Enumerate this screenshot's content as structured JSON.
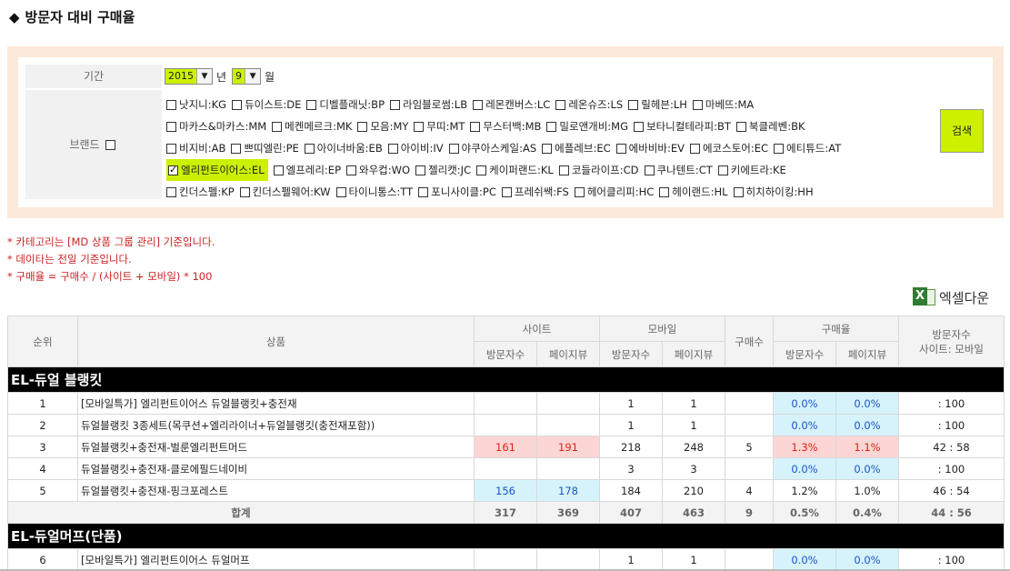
{
  "page": {
    "title": "방문자 대비 구매율",
    "title_icon": "◆"
  },
  "filter": {
    "period_label": "기간",
    "year_value": "2015",
    "year_unit": "년",
    "month_value": "9",
    "month_unit": "월",
    "brand_label": "브랜드",
    "search_label": "검색",
    "brand_rows": [
      [
        {
          "label": "낫지니:KG",
          "checked": false
        },
        {
          "label": "듀이스트:DE",
          "checked": false
        },
        {
          "label": "디벨플래닛:BP",
          "checked": false
        },
        {
          "label": "라임블로썸:LB",
          "checked": false
        },
        {
          "label": "레몬캔버스:LC",
          "checked": false
        },
        {
          "label": "레온슈즈:LS",
          "checked": false
        },
        {
          "label": "릴헤븐:LH",
          "checked": false
        },
        {
          "label": "마베뜨:MA",
          "checked": false
        }
      ],
      [
        {
          "label": "마카스&마카스:MM",
          "checked": false
        },
        {
          "label": "메켄메르크:MK",
          "checked": false
        },
        {
          "label": "모음:MY",
          "checked": false
        },
        {
          "label": "무띠:MT",
          "checked": false
        },
        {
          "label": "무스터백:MB",
          "checked": false
        },
        {
          "label": "밀로앤개비:MG",
          "checked": false
        },
        {
          "label": "보타니컬테라피:BT",
          "checked": false
        },
        {
          "label": "북클레벤:BK",
          "checked": false
        }
      ],
      [
        {
          "label": "비지비:AB",
          "checked": false
        },
        {
          "label": "쁘띠엘린:PE",
          "checked": false
        },
        {
          "label": "아이너바움:EB",
          "checked": false
        },
        {
          "label": "아이비:IV",
          "checked": false
        },
        {
          "label": "야쿠아스케일:AS",
          "checked": false
        },
        {
          "label": "에플레브:EC",
          "checked": false
        },
        {
          "label": "에바비바:EV",
          "checked": false
        },
        {
          "label": "에코스토어:EC",
          "checked": false
        },
        {
          "label": "에티튜드:AT",
          "checked": false
        }
      ],
      [
        {
          "label": "엘리펀트이어스:EL",
          "checked": true
        },
        {
          "label": "엘프레리:EP",
          "checked": false
        },
        {
          "label": "와우컵:WO",
          "checked": false
        },
        {
          "label": "젤리캣:JC",
          "checked": false
        },
        {
          "label": "케이퍼랜드:KL",
          "checked": false
        },
        {
          "label": "코들라이프:CD",
          "checked": false
        },
        {
          "label": "쿠나텐트:CT",
          "checked": false
        },
        {
          "label": "키에트라:KE",
          "checked": false
        }
      ],
      [
        {
          "label": "킨더스펠:KP",
          "checked": false
        },
        {
          "label": "킨더스펠웨어:KW",
          "checked": false
        },
        {
          "label": "타이니통스:TT",
          "checked": false
        },
        {
          "label": "포니사이클:PC",
          "checked": false
        },
        {
          "label": "프레쉬쌕:FS",
          "checked": false
        },
        {
          "label": "헤어클리피:HC",
          "checked": false
        },
        {
          "label": "헤이랜드:HL",
          "checked": false
        },
        {
          "label": "히치하이킹:HH",
          "checked": false
        }
      ]
    ]
  },
  "notes": [
    "* 카테고리는 [MD 상품 그룹 관리] 기준입니다.",
    "* 데이타는 전일 기준입니다.",
    "* 구매율 = 구매수 / (사이트 + 모바일) * 100"
  ],
  "excel_label": "엑셀다운",
  "table": {
    "headers": {
      "rank": "순위",
      "product": "상품",
      "site": "사이트",
      "mobile": "모바일",
      "purchases": "구매수",
      "rate": "구매율",
      "ratio": "방문자수\n사이트: 모바일",
      "visitors": "방문자수",
      "pageviews": "페이지뷰"
    },
    "groups": [
      {
        "name": "EL-듀얼 블랭킷",
        "rows": [
          {
            "rank": "1",
            "name": "[모바일특가] 엘리펀트이어스 듀얼블랭킷+충전재",
            "sv": "",
            "sp": "",
            "mv": "1",
            "mp": "1",
            "buy": "",
            "rv": "0.0%",
            "rp": "0.0%",
            "ratio": ": 100",
            "style": "blue"
          },
          {
            "rank": "2",
            "name": "듀얼블랭킷 3종세트(목쿠션+엘리라이너+듀얼블랭킷(충전재포함))",
            "sv": "",
            "sp": "",
            "mv": "1",
            "mp": "1",
            "buy": "",
            "rv": "0.0%",
            "rp": "0.0%",
            "ratio": ": 100",
            "style": "blue"
          },
          {
            "rank": "3",
            "name": "듀얼블랭킷+충전재-벌룬엘리펀트머드",
            "sv": "161",
            "sp": "191",
            "mv": "218",
            "mp": "248",
            "buy": "5",
            "rv": "1.3%",
            "rp": "1.1%",
            "ratio": "42 : 58",
            "style": "pink"
          },
          {
            "rank": "4",
            "name": "듀얼블랭킷+충전재-클로에필드네이비",
            "sv": "",
            "sp": "",
            "mv": "3",
            "mp": "3",
            "buy": "",
            "rv": "0.0%",
            "rp": "0.0%",
            "ratio": ": 100",
            "style": "blue"
          },
          {
            "rank": "5",
            "name": "듀얼블랭킷+충전재-핑크포레스트",
            "sv": "156",
            "sp": "178",
            "mv": "184",
            "mp": "210",
            "buy": "4",
            "rv": "1.2%",
            "rp": "1.0%",
            "ratio": "46 : 54",
            "style": "siteblue"
          }
        ],
        "sum": {
          "label": "합계",
          "sv": "317",
          "sp": "369",
          "mv": "407",
          "mp": "463",
          "buy": "9",
          "rv": "0.5%",
          "rp": "0.4%",
          "ratio": "44 : 56"
        }
      },
      {
        "name": "EL-듀얼머프(단품)",
        "rows": [
          {
            "rank": "6",
            "name": "[모바일특가] 엘리펀트이어스 듀얼머프",
            "sv": "",
            "sp": "",
            "mv": "1",
            "mp": "1",
            "buy": "",
            "rv": "0.0%",
            "rp": "0.0%",
            "ratio": ": 100",
            "style": "blue"
          }
        ]
      }
    ]
  }
}
